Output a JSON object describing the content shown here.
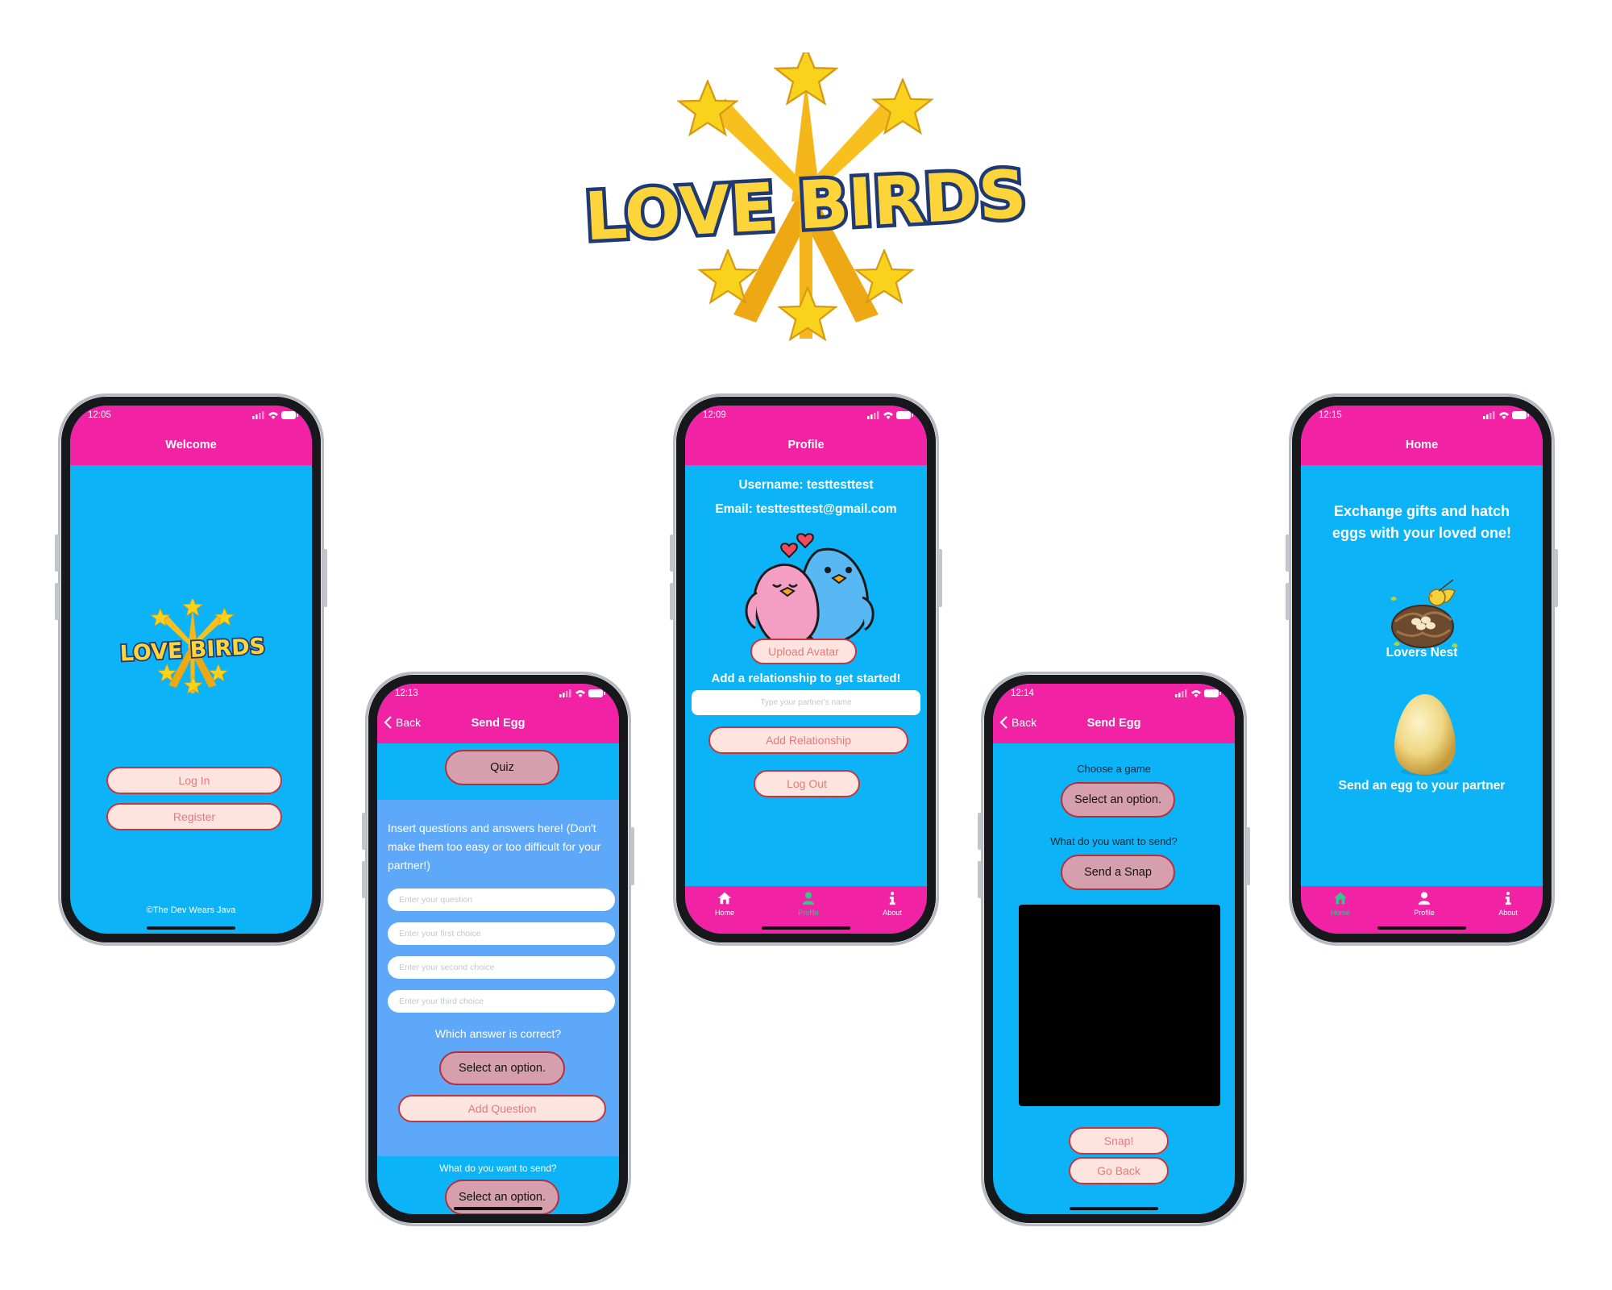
{
  "logo_text": "LOVE BIRDS",
  "colors": {
    "header": "#f122a4",
    "background": "#0cb4f7",
    "quiz_panel": "#5ea8fa",
    "tab_active": "#2ecb8b",
    "button_light": "#fde4df",
    "button_dark": "#d69fae",
    "button_border": "#c4363d"
  },
  "welcome": {
    "time": "12:05",
    "title": "Welcome",
    "logo_text": "LOVE BIRDS",
    "login": "Log In",
    "register": "Register",
    "footer": "©The Dev Wears Java"
  },
  "quiz": {
    "time": "12:13",
    "back": "Back",
    "title": "Send Egg",
    "quiz_button": "Quiz",
    "instructions": "Insert questions and answers here! (Don't make them too easy or too difficult for your partner!)",
    "fields": [
      "Enter your question",
      "Enter your first choice",
      "Enter your second choice",
      "Enter your third choice"
    ],
    "which_correct": "Which answer is correct?",
    "select1": "Select an option.",
    "add_question": "Add Question",
    "send_prompt": "What do you want to send?",
    "select2": "Select an option."
  },
  "profile": {
    "time": "12:09",
    "title": "Profile",
    "username": "Username: testtesttest",
    "email": "Email: testtesttest@gmail.com",
    "upload": "Upload Avatar",
    "add_prompt": "Add a relationship to get started!",
    "partner_placeholder": "Type your partner's name",
    "add_relationship": "Add Relationship",
    "logout": "Log Out"
  },
  "snap": {
    "time": "12:14",
    "back": "Back",
    "title": "Send Egg",
    "choose_game": "Choose a game",
    "select": "Select an option.",
    "send_prompt": "What do you want to send?",
    "send_snap": "Send a Snap",
    "snap": "Snap!",
    "go_back": "Go Back"
  },
  "home": {
    "time": "12:15",
    "title": "Home",
    "headline": "Exchange gifts and hatch eggs with your loved one!",
    "nest": "Lovers Nest",
    "send_egg": "Send an egg to your partner"
  },
  "tabs": {
    "home": "Home",
    "profile": "Profile",
    "about": "About"
  }
}
